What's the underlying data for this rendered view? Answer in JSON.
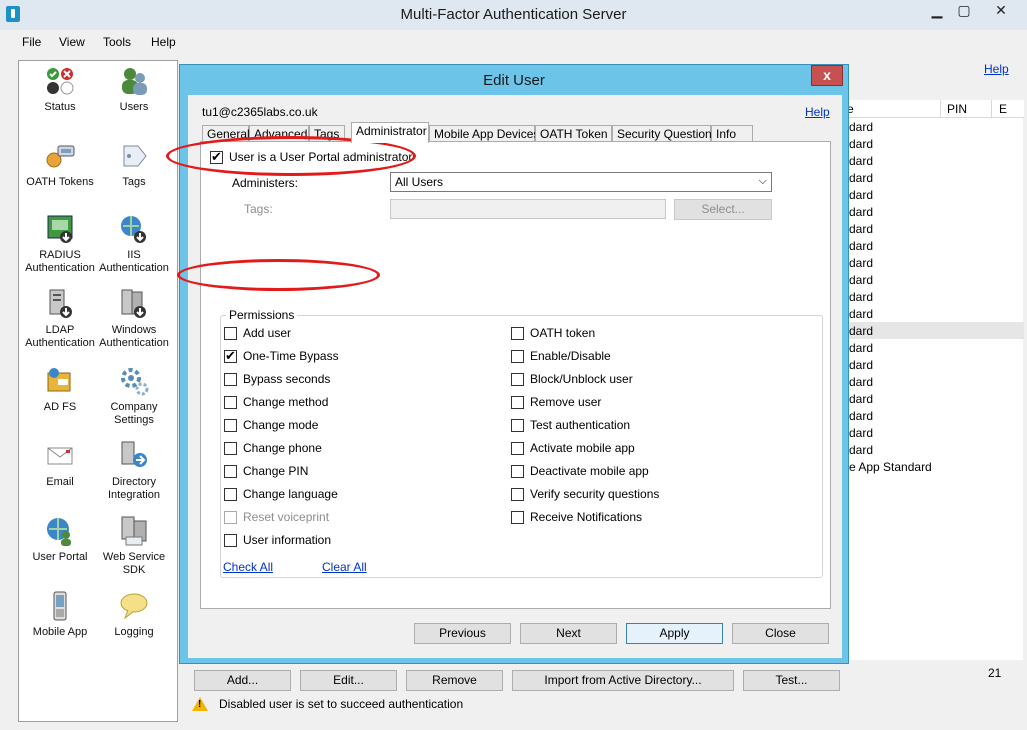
{
  "window": {
    "title": "Multi-Factor Authentication Server",
    "controls": {
      "minimize": "▁",
      "maximize": "▢",
      "close": "✕"
    }
  },
  "menu": [
    "File",
    "View",
    "Tools",
    "Help"
  ],
  "sidebar": [
    {
      "label": "Status",
      "icon": "status-icon"
    },
    {
      "label": "Users",
      "icon": "users-icon"
    },
    {
      "label": "OATH Tokens",
      "icon": "oath-tokens-icon"
    },
    {
      "label": "Tags",
      "icon": "tags-icon"
    },
    {
      "label": "RADIUS Authentication",
      "icon": "radius-icon"
    },
    {
      "label": "IIS Authentication",
      "icon": "iis-icon"
    },
    {
      "label": "LDAP Authentication",
      "icon": "ldap-icon"
    },
    {
      "label": "Windows Authentication",
      "icon": "windows-auth-icon"
    },
    {
      "label": "AD FS",
      "icon": "adfs-icon"
    },
    {
      "label": "Company Settings",
      "icon": "company-settings-icon"
    },
    {
      "label": "Email",
      "icon": "email-icon"
    },
    {
      "label": "Directory Integration",
      "icon": "directory-integration-icon"
    },
    {
      "label": "User Portal",
      "icon": "user-portal-icon"
    },
    {
      "label": "Web Service SDK",
      "icon": "web-service-sdk-icon"
    },
    {
      "label": "Mobile App",
      "icon": "mobile-app-icon"
    },
    {
      "label": "Logging",
      "icon": "logging-icon"
    }
  ],
  "main": {
    "help": "Help",
    "columns": [
      "e",
      "PIN",
      "E"
    ],
    "rows": [
      "dard",
      "dard",
      "dard",
      "dard",
      "dard",
      "dard",
      "dard",
      "dard",
      "dard",
      "dard",
      "dard",
      "dard",
      "dard",
      "dard",
      "dard",
      "dard",
      "dard",
      "dard",
      "dard",
      "dard",
      "e App Standard"
    ],
    "count": "21",
    "buttons": [
      "Add...",
      "Edit...",
      "Remove",
      "Import from Active Directory...",
      "Test..."
    ],
    "status": "Disabled user is set to succeed authentication"
  },
  "dialog": {
    "title": "Edit User",
    "close": "x",
    "email": "tu1@c2365labs.co.uk",
    "help": "Help",
    "tabs": [
      "General",
      "Advanced",
      "Tags",
      "Administrator",
      "Mobile App Devices",
      "OATH Token",
      "Security Questions",
      "Info"
    ],
    "active_tab": "Administrator",
    "portal_admin_label": "User is a User Portal administrator",
    "portal_admin_checked": true,
    "administers_label": "Administers:",
    "administers_value": "All Users",
    "tags_label": "Tags:",
    "select_button": "Select...",
    "permissions_title": "Permissions",
    "permissions_left": [
      {
        "label": "Add user",
        "checked": false,
        "disabled": false
      },
      {
        "label": "One-Time Bypass",
        "checked": true,
        "disabled": false
      },
      {
        "label": "Bypass seconds",
        "checked": false,
        "disabled": false
      },
      {
        "label": "Change method",
        "checked": false,
        "disabled": false
      },
      {
        "label": "Change mode",
        "checked": false,
        "disabled": false
      },
      {
        "label": "Change phone",
        "checked": false,
        "disabled": false
      },
      {
        "label": "Change PIN",
        "checked": false,
        "disabled": false
      },
      {
        "label": "Change language",
        "checked": false,
        "disabled": false
      },
      {
        "label": "Reset voiceprint",
        "checked": false,
        "disabled": true
      },
      {
        "label": "User information",
        "checked": false,
        "disabled": false
      }
    ],
    "permissions_right": [
      {
        "label": "OATH token",
        "checked": false,
        "disabled": false
      },
      {
        "label": "Enable/Disable",
        "checked": false,
        "disabled": false
      },
      {
        "label": "Block/Unblock user",
        "checked": false,
        "disabled": false
      },
      {
        "label": "Remove user",
        "checked": false,
        "disabled": false
      },
      {
        "label": "Test authentication",
        "checked": false,
        "disabled": false
      },
      {
        "label": "Activate mobile app",
        "checked": false,
        "disabled": false
      },
      {
        "label": "Deactivate mobile app",
        "checked": false,
        "disabled": false
      },
      {
        "label": "Verify security questions",
        "checked": false,
        "disabled": false
      },
      {
        "label": "Receive Notifications",
        "checked": false,
        "disabled": false
      }
    ],
    "check_all": "Check All",
    "clear_all": "Clear All",
    "footer_buttons": [
      "Previous",
      "Next",
      "Apply",
      "Close"
    ]
  },
  "colors": {
    "dialog_frame": "#6cc5e9",
    "annotation": "#e21a1a",
    "link": "#0033cc"
  }
}
